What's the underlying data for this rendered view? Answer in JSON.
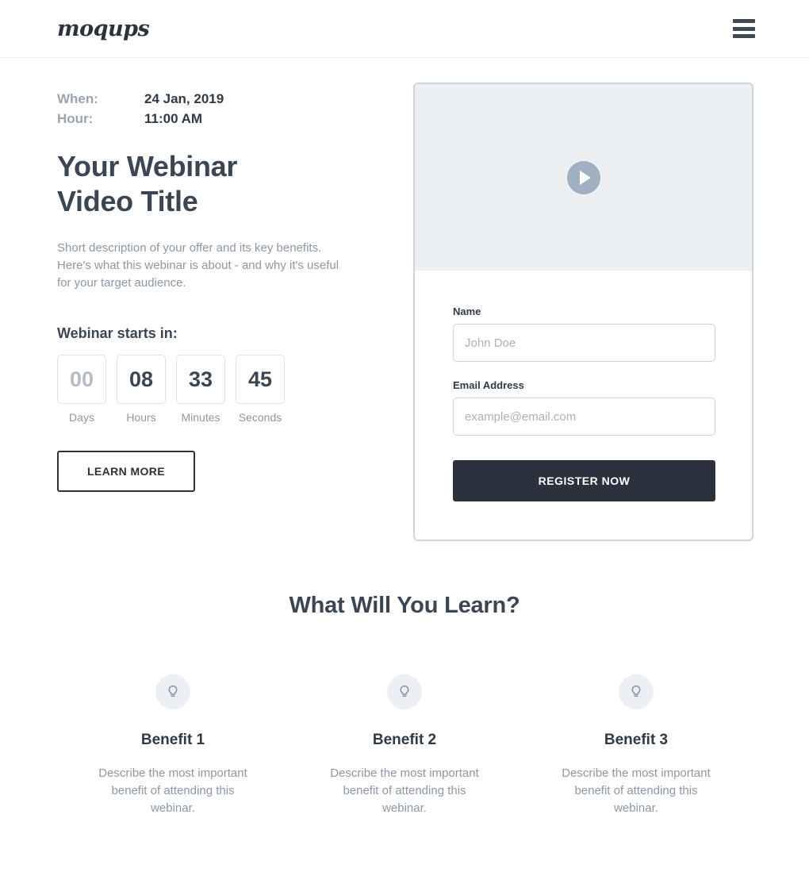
{
  "header": {
    "logo_text": "moqups",
    "menu_icon": "hamburger-menu-icon"
  },
  "hero": {
    "when_label": "When:",
    "when_value": "24 Jan, 2019",
    "hour_label": "Hour:",
    "hour_value": "11:00 AM",
    "title_line1": "Your Webinar",
    "title_line2": "Video Title",
    "description": "Short description of your offer and its key benefits. Here's what this webinar is about - and why it's useful for your target audience.",
    "learn_more_label": "LEARN MORE"
  },
  "countdown": {
    "title": "Webinar starts in:",
    "units": [
      {
        "value": "00",
        "label": "Days",
        "dim": true
      },
      {
        "value": "08",
        "label": "Hours",
        "dim": false
      },
      {
        "value": "33",
        "label": "Minutes",
        "dim": false
      },
      {
        "value": "45",
        "label": "Seconds",
        "dim": false
      }
    ]
  },
  "registration": {
    "play_icon": "play-button-icon",
    "name_label": "Name",
    "name_value": "",
    "name_placeholder": "John Doe",
    "email_label": "Email Address",
    "email_value": "",
    "email_placeholder": "example@email.com",
    "submit_label": "REGISTER NOW"
  },
  "benefits_section": {
    "heading": "What Will You Learn?",
    "items": [
      {
        "icon": "lightbulb-icon",
        "title": "Benefit 1",
        "description": "Describe the most important benefit of attending this webinar."
      },
      {
        "icon": "lightbulb-icon",
        "title": "Benefit 2",
        "description": "Describe the most important benefit of attending this webinar."
      },
      {
        "icon": "lightbulb-icon",
        "title": "Benefit 3",
        "description": "Describe the most important benefit of attending this webinar."
      }
    ]
  },
  "colors": {
    "ink": "#2b323d",
    "heading": "#3b4654",
    "muted": "#8d98a7",
    "border": "#ccd6e0",
    "video_bg": "#edf0f2",
    "accent_dark": "#2b323d",
    "play_circle": "#9fb0c4"
  }
}
